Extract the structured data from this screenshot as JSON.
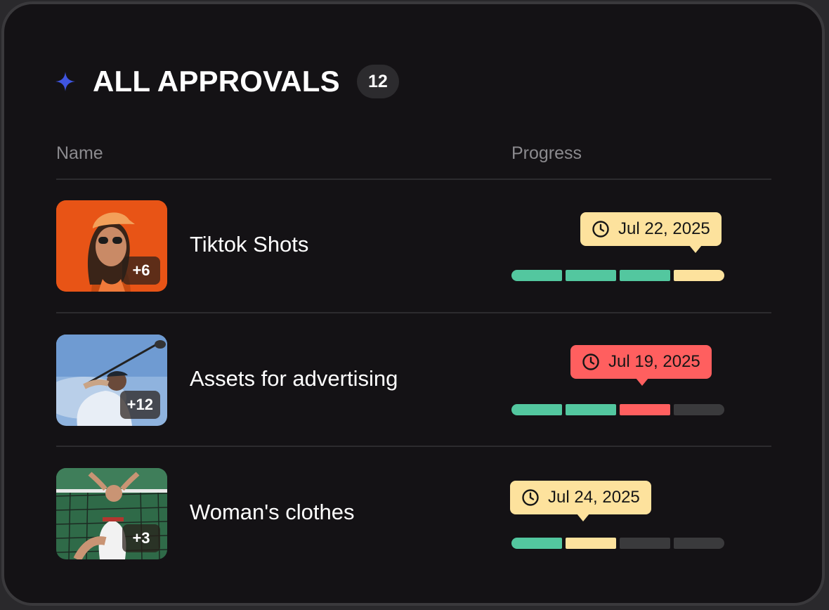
{
  "header": {
    "title": "ALL APPROVALS",
    "count": "12",
    "icon": "sparkle-icon"
  },
  "columns": {
    "name": "Name",
    "progress": "Progress"
  },
  "colors": {
    "done": "#53c79f",
    "pending": "#fde29d",
    "overdue": "#ff5f5f",
    "empty": "#3a3a3c",
    "accent": "#3f55e0"
  },
  "rows": [
    {
      "name": "Tiktok Shots",
      "extra": "+6",
      "due": "Jul 22, 2025",
      "status": "pending",
      "segments": [
        "done",
        "done",
        "done",
        "pending"
      ]
    },
    {
      "name": "Assets for advertising",
      "extra": "+12",
      "due": "Jul 19, 2025",
      "status": "overdue",
      "segments": [
        "done",
        "done",
        "overdue",
        "empty"
      ]
    },
    {
      "name": "Woman's clothes",
      "extra": "+3",
      "due": "Jul 24, 2025",
      "status": "pending",
      "segments": [
        "done",
        "pending",
        "empty",
        "empty"
      ]
    }
  ]
}
